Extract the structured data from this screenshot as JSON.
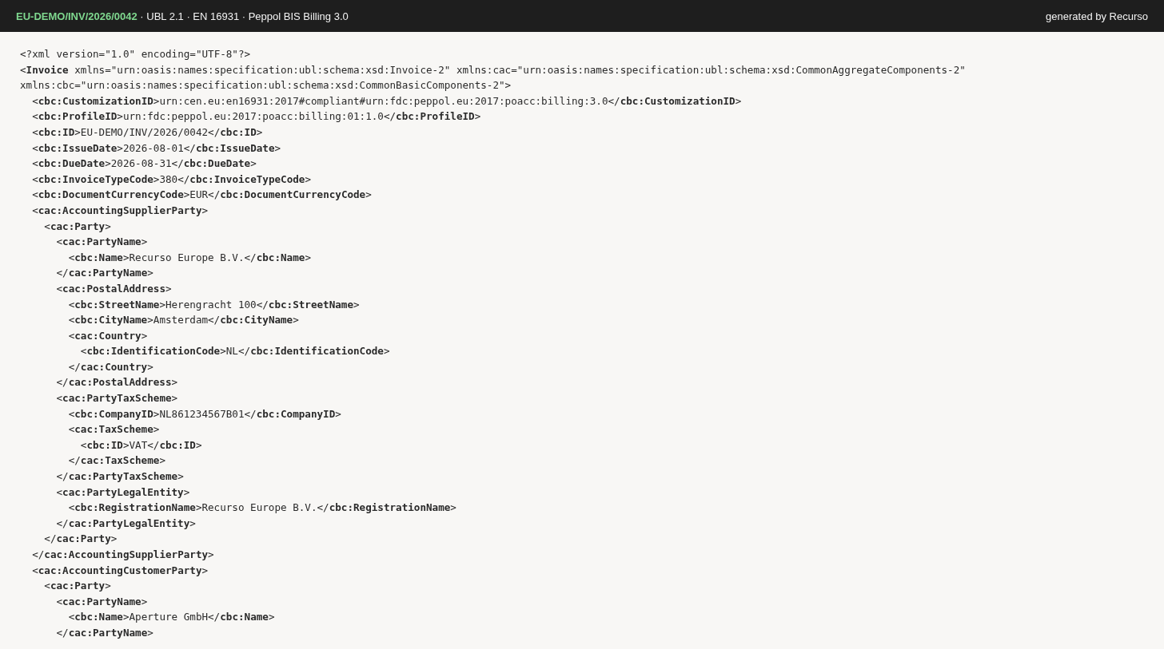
{
  "header": {
    "doc_id": "EU-DEMO/INV/2026/0042",
    "details": " · UBL 2.1 · EN 16931 · Peppol BIS Billing 3.0",
    "credit": "generated by Recurso"
  },
  "xml": {
    "declaration": "<?xml version=\"1.0\" encoding=\"UTF-8\"?>",
    "root": {
      "open": "<**Invoice** xmlns=\"urn:oasis:names:specification:ubl:schema:xsd:Invoice-2\" xmlns:cac=\"urn:oasis:names:specification:ubl:schema:xsd:CommonAggregateComponents-2\" xmlns:cbc=\"urn:oasis:names:specification:ubl:schema:xsd:CommonBasicComponents-2\">",
      "children": [
        {
          "line": "<**cbc:CustomizationID**>urn:cen.eu:en16931:2017#compliant#urn:fdc:peppol.eu:2017:poacc:billing:3.0</**cbc:CustomizationID**>"
        },
        {
          "line": "<**cbc:ProfileID**>urn:fdc:peppol.eu:2017:poacc:billing:01:1.0</**cbc:ProfileID**>"
        },
        {
          "line": "<**cbc:ID**>EU-DEMO/INV/2026/0042</**cbc:ID**>"
        },
        {
          "line": "<**cbc:IssueDate**>2026-08-01</**cbc:IssueDate**>"
        },
        {
          "line": "<**cbc:DueDate**>2026-08-31</**cbc:DueDate**>"
        },
        {
          "line": "<**cbc:InvoiceTypeCode**>380</**cbc:InvoiceTypeCode**>"
        },
        {
          "line": "<**cbc:DocumentCurrencyCode**>EUR</**cbc:DocumentCurrencyCode**>"
        },
        {
          "open": "<**cac:AccountingSupplierParty**>",
          "close": "</**cac:AccountingSupplierParty**>",
          "children": [
            {
              "open": "<**cac:Party**>",
              "close": "</**cac:Party**>",
              "children": [
                {
                  "open": "<**cac:PartyName**>",
                  "close": "</**cac:PartyName**>",
                  "children": [
                    {
                      "line": "<**cbc:Name**>Recurso Europe B.V.</**cbc:Name**>"
                    }
                  ]
                },
                {
                  "open": "<**cac:PostalAddress**>",
                  "close": "</**cac:PostalAddress**>",
                  "children": [
                    {
                      "line": "<**cbc:StreetName**>Herengracht 100</**cbc:StreetName**>"
                    },
                    {
                      "line": "<**cbc:CityName**>Amsterdam</**cbc:CityName**>"
                    },
                    {
                      "open": "<**cac:Country**>",
                      "close": "</**cac:Country**>",
                      "children": [
                        {
                          "line": "<**cbc:IdentificationCode**>NL</**cbc:IdentificationCode**>"
                        }
                      ]
                    }
                  ]
                },
                {
                  "open": "<**cac:PartyTaxScheme**>",
                  "close": "</**cac:PartyTaxScheme**>",
                  "children": [
                    {
                      "line": "<**cbc:CompanyID**>NL861234567B01</**cbc:CompanyID**>"
                    },
                    {
                      "open": "<**cac:TaxScheme**>",
                      "close": "</**cac:TaxScheme**>",
                      "children": [
                        {
                          "line": "<**cbc:ID**>VAT</**cbc:ID**>"
                        }
                      ]
                    }
                  ]
                },
                {
                  "open": "<**cac:PartyLegalEntity**>",
                  "close": "</**cac:PartyLegalEntity**>",
                  "children": [
                    {
                      "line": "<**cbc:RegistrationName**>Recurso Europe B.V.</**cbc:RegistrationName**>"
                    }
                  ]
                }
              ]
            }
          ]
        },
        {
          "open": "<**cac:AccountingCustomerParty**>",
          "children": [
            {
              "open": "<**cac:Party**>",
              "children": [
                {
                  "open": "<**cac:PartyName**>",
                  "close": "</**cac:PartyName**>",
                  "children": [
                    {
                      "line": "<**cbc:Name**>Aperture GmbH</**cbc:Name**>"
                    }
                  ]
                }
              ]
            }
          ]
        }
      ]
    }
  }
}
